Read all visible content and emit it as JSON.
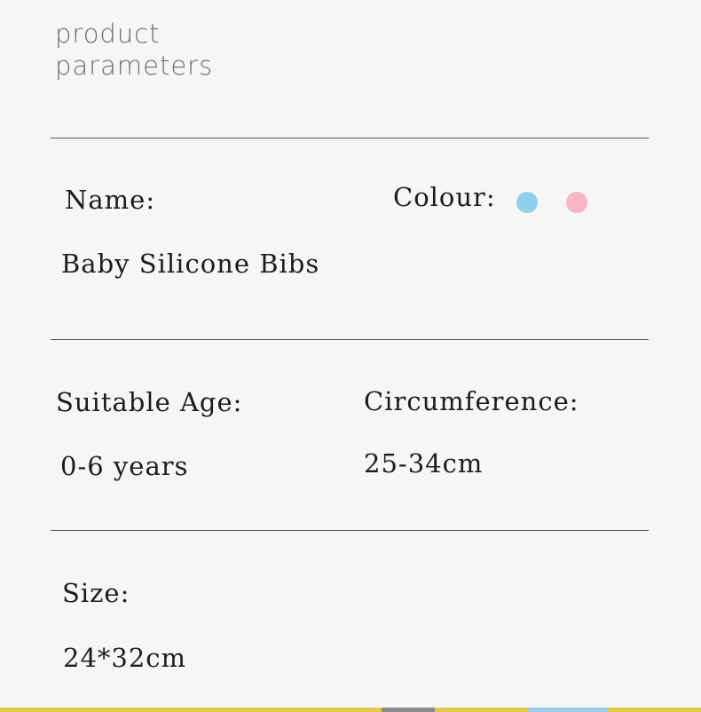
{
  "section_title": {
    "line1": "product",
    "line2": "parameters"
  },
  "fields": {
    "name": {
      "label": "Name:",
      "value": "Baby Silicone Bibs"
    },
    "colour": {
      "label": "Colour:",
      "swatches": [
        {
          "name": "blue",
          "color": "#8fd0ea"
        },
        {
          "name": "pink",
          "color": "#f6b6c3"
        }
      ]
    },
    "suitable_age": {
      "label": "Suitable Age:",
      "value": "0-6 years"
    },
    "circumference": {
      "label": "Circumference:",
      "value": "25-34cm"
    },
    "size": {
      "label": "Size:",
      "value": "24*32cm"
    }
  },
  "colors": {
    "background": "#f6f6f6",
    "rule": "#555555",
    "heading": "#6d6d6d",
    "bottom_strip": "#e7c94a"
  }
}
